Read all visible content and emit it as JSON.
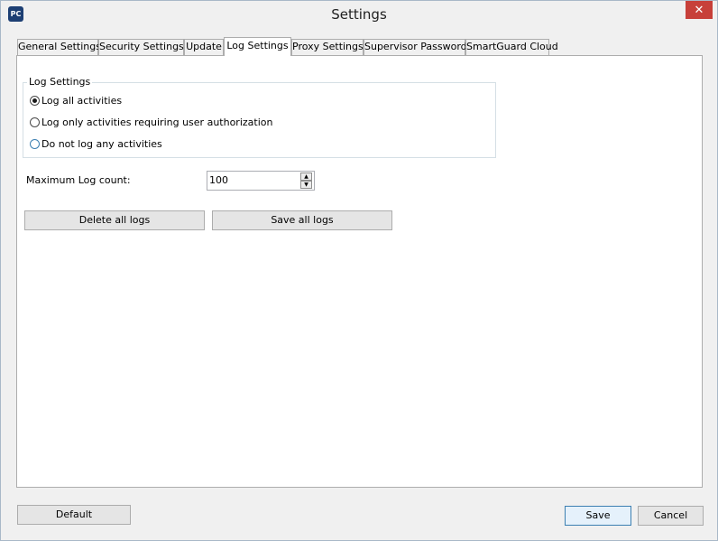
{
  "window": {
    "title": "Settings",
    "app_icon_text": "PC"
  },
  "tabs": [
    {
      "label": "General Settings"
    },
    {
      "label": "Security Settings"
    },
    {
      "label": "Update"
    },
    {
      "label": "Log Settings"
    },
    {
      "label": "Proxy Settings"
    },
    {
      "label": "Supervisor Password"
    },
    {
      "label": "SmartGuard Cloud"
    }
  ],
  "active_tab": "Log Settings",
  "log_group": {
    "title": "Log Settings",
    "options": [
      {
        "label": "Log all activities",
        "selected": true
      },
      {
        "label": "Log only activities requiring user authorization",
        "selected": false
      },
      {
        "label": "Do not log any activities",
        "selected": false
      }
    ]
  },
  "max_log": {
    "label": "Maximum Log count:",
    "value": "100"
  },
  "actions": {
    "delete_label": "Delete all logs",
    "save_logs_label": "Save all logs"
  },
  "footer": {
    "default_label": "Default",
    "save_label": "Save",
    "cancel_label": "Cancel"
  },
  "icons": {
    "close": "close-icon",
    "spin_up": "up-arrow-icon",
    "spin_down": "down-arrow-icon"
  },
  "colors": {
    "close_button": "#c7403a",
    "app_icon": "#1d3f73",
    "focus_border": "#3c7fb1"
  }
}
